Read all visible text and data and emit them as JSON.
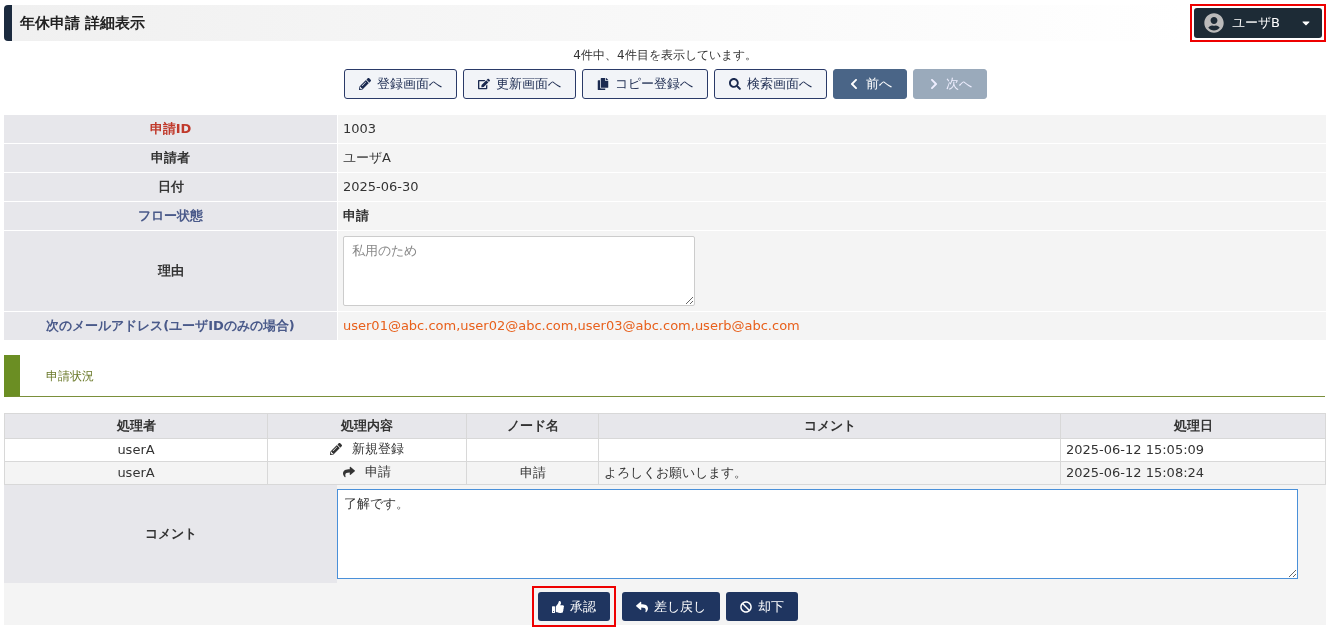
{
  "header": {
    "title": "年休申請 詳細表示",
    "user_menu": {
      "label": "ユーザB",
      "highlighted": true
    }
  },
  "record_info": "4件中、4件目を表示しています。",
  "nav_buttons": [
    {
      "label": "登録画面へ",
      "kind": "outline",
      "disabled": false
    },
    {
      "label": "更新画面へ",
      "kind": "outline",
      "disabled": false
    },
    {
      "label": "コピー登録へ",
      "kind": "outline",
      "disabled": false
    },
    {
      "label": "検索画面へ",
      "kind": "outline",
      "disabled": false
    },
    {
      "label": "前へ",
      "kind": "solid",
      "disabled": false
    },
    {
      "label": "次へ",
      "kind": "solid",
      "disabled": true
    }
  ],
  "fields": [
    {
      "label": "申請ID",
      "color": "#c0392b",
      "kind": "text",
      "value": "1003",
      "bold": false
    },
    {
      "label": "申請者",
      "color": "#333333",
      "kind": "text",
      "value": "ユーザA",
      "bold": false
    },
    {
      "label": "日付",
      "color": "#333333",
      "kind": "text",
      "value": "2025-06-30",
      "bold": false
    },
    {
      "label": "フロー状態",
      "color": "#4a5a8a",
      "kind": "text",
      "value": "申請",
      "bold": true
    },
    {
      "label": "理由",
      "color": "#333333",
      "kind": "textarea",
      "placeholder": "私用のため",
      "bold": false
    },
    {
      "label": "次のメールアドレス(ユーザIDのみの場合)",
      "color": "#4a5a8a",
      "kind": "link",
      "value": "user01@abc.com,user02@abc.com,user03@abc.com,userb@abc.com",
      "bold": false
    }
  ],
  "section": {
    "title": "申請状況"
  },
  "history": {
    "columns": [
      "処理者",
      "処理内容",
      "ノード名",
      "コメント",
      "処理日"
    ],
    "rows": [
      {
        "user": "userA",
        "action": "新規登録",
        "kind": "create",
        "node": "",
        "comment": "",
        "date": "2025-06-12 15:05:09"
      },
      {
        "user": "userA",
        "action": "申請",
        "kind": "submit",
        "node": "申請",
        "comment": "よろしくお願いします。",
        "date": "2025-06-12 15:08:24"
      }
    ]
  },
  "comment": {
    "label": "コメント",
    "value": "了解です。"
  },
  "actions": [
    {
      "label": "承認",
      "highlighted": true
    },
    {
      "label": "差し戻し",
      "highlighted": false
    },
    {
      "label": "却下",
      "highlighted": false
    }
  ]
}
